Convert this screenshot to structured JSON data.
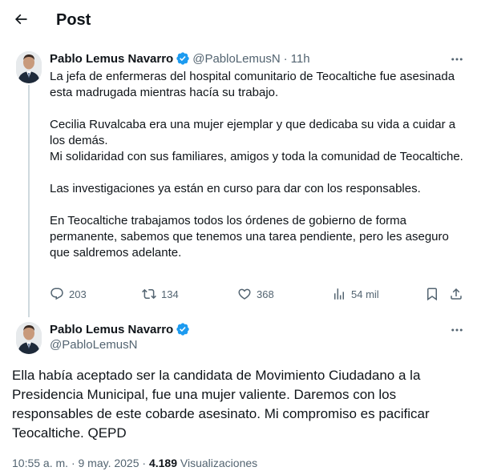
{
  "header": {
    "title": "Post"
  },
  "icons": {
    "back": "arrow-left-icon",
    "verified": "verified-badge-icon",
    "more": "more-horizontal-icon"
  },
  "colors": {
    "verified": "#1d9bf0",
    "text": "#0f1419",
    "muted": "#536471",
    "thread_line": "#cfd9de"
  },
  "tweet1": {
    "name": "Pablo Lemus Navarro",
    "handle": "@PabloLemusN",
    "separator": "·",
    "time": "11h",
    "paragraphs": [
      "La jefa de enfermeras del hospital comunitario de Teocaltiche fue asesinada esta madrugada mientras hacía su trabajo.",
      "",
      "Cecilia Ruvalcaba era una mujer ejemplar y que dedicaba su vida a cuidar a los demás.",
      "Mi solidaridad con sus familiares, amigos y toda la comunidad de Teocaltiche.",
      "",
      "Las investigaciones ya están en curso para dar con los responsables.",
      "",
      "En Teocaltiche trabajamos todos los órdenes de gobierno de forma permanente, sabemos que tenemos una tarea pendiente, pero les aseguro que saldremos adelante."
    ],
    "actions": {
      "replies": "203",
      "reposts": "134",
      "likes": "368",
      "views": "54 mil"
    }
  },
  "tweet2": {
    "name": "Pablo Lemus Navarro",
    "handle": "@PabloLemusN",
    "text": "Ella había aceptado ser la candidata de Movimiento Ciudadano a la Presidencia Municipal, fue una mujer valiente. Daremos con los responsables de este cobarde asesinato. Mi compromiso es pacificar Teocaltiche. QEPD",
    "time": "10:55 a. m.",
    "separator": "·",
    "date": "9 may. 2025",
    "views_count": "4.189",
    "views_label": "Visualizaciones"
  }
}
